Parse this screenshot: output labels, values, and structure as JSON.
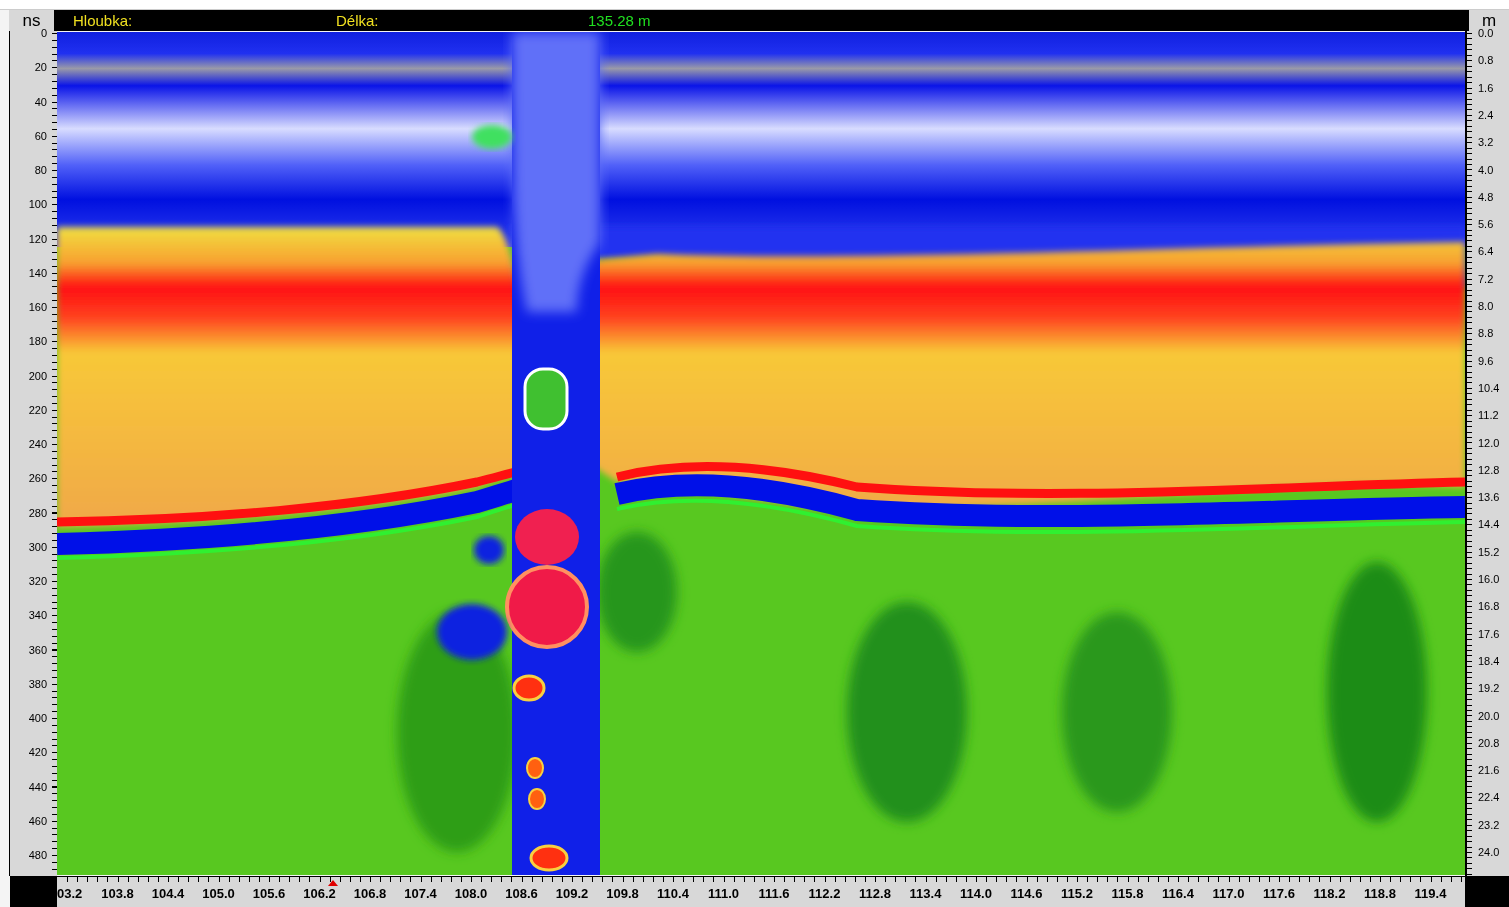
{
  "header": {
    "depth_label": "Hloubka:",
    "length_label": "Délka:",
    "length_value": "135.28 m"
  },
  "left_axis": {
    "unit": "ns",
    "ticks": [
      "0",
      "20",
      "40",
      "60",
      "80",
      "100",
      "120",
      "140",
      "160",
      "180",
      "200",
      "220",
      "240",
      "260",
      "280",
      "300",
      "320",
      "340",
      "360",
      "380",
      "400",
      "420",
      "440",
      "460",
      "480"
    ]
  },
  "right_axis": {
    "unit": "m",
    "ticks": [
      "0.0",
      "0.8",
      "1.6",
      "2.4",
      "3.2",
      "4.0",
      "4.8",
      "5.6",
      "6.4",
      "7.2",
      "8.0",
      "8.8",
      "9.6",
      "10.4",
      "11.2",
      "12.0",
      "12.8",
      "13.6",
      "14.4",
      "15.2",
      "16.0",
      "16.8",
      "17.6",
      "18.4",
      "19.2",
      "20.0",
      "20.8",
      "21.6",
      "22.4",
      "23.2",
      "24.0"
    ]
  },
  "bottom_axis": {
    "ticks": [
      "03.2",
      "103.8",
      "104.4",
      "105.0",
      "105.6",
      "106.2",
      "106.8",
      "107.4",
      "108.0",
      "108.6",
      "109.2",
      "109.8",
      "110.4",
      "111.0",
      "111.6",
      "112.2",
      "112.8",
      "113.4",
      "114.0",
      "114.6",
      "115.2",
      "115.8",
      "116.4",
      "117.0",
      "117.6",
      "118.2",
      "118.8",
      "119.4"
    ]
  }
}
